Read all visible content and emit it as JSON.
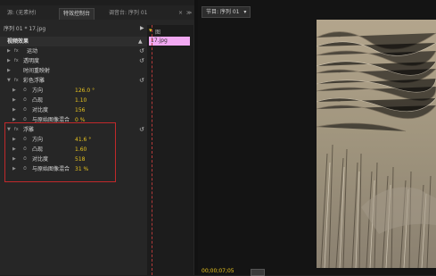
{
  "left_tabs": {
    "tab1": "源: (无素材)",
    "tab2": "特效控制台",
    "tab3": "调音台: 序列 01",
    "close": "×",
    "more": "≫"
  },
  "sequence_label": "序列 01 * 17.jpg",
  "clip_name": "17.jpg",
  "timeline_label": "图",
  "video_effects_header": "视频效果",
  "effects": [
    {
      "label": "运动",
      "prefix": "fx 🎥"
    },
    {
      "label": "透明度",
      "prefix": "fx"
    },
    {
      "label": "时间重映射",
      "prefix": ""
    }
  ],
  "emboss_color": {
    "name": "彩色浮雕",
    "props": [
      {
        "label": "方向",
        "value": "126.0 °"
      },
      {
        "label": "凸现",
        "value": "1.10"
      },
      {
        "label": "对比度",
        "value": "156"
      },
      {
        "label": "与原始图像混合",
        "value": "0 %"
      }
    ]
  },
  "emboss": {
    "name": "浮雕",
    "props": [
      {
        "label": "方向",
        "value": "41.6 °"
      },
      {
        "label": "凸现",
        "value": "1.60"
      },
      {
        "label": "对比度",
        "value": "518"
      },
      {
        "label": "与原始图像混合",
        "value": "31 %"
      }
    ]
  },
  "program_tab": "节目: 序列 01",
  "timecode": "00;00;07;05",
  "colors": {
    "value": "#e6c21f",
    "clip": "#f2a9f2",
    "highlight": "#c0292b"
  }
}
